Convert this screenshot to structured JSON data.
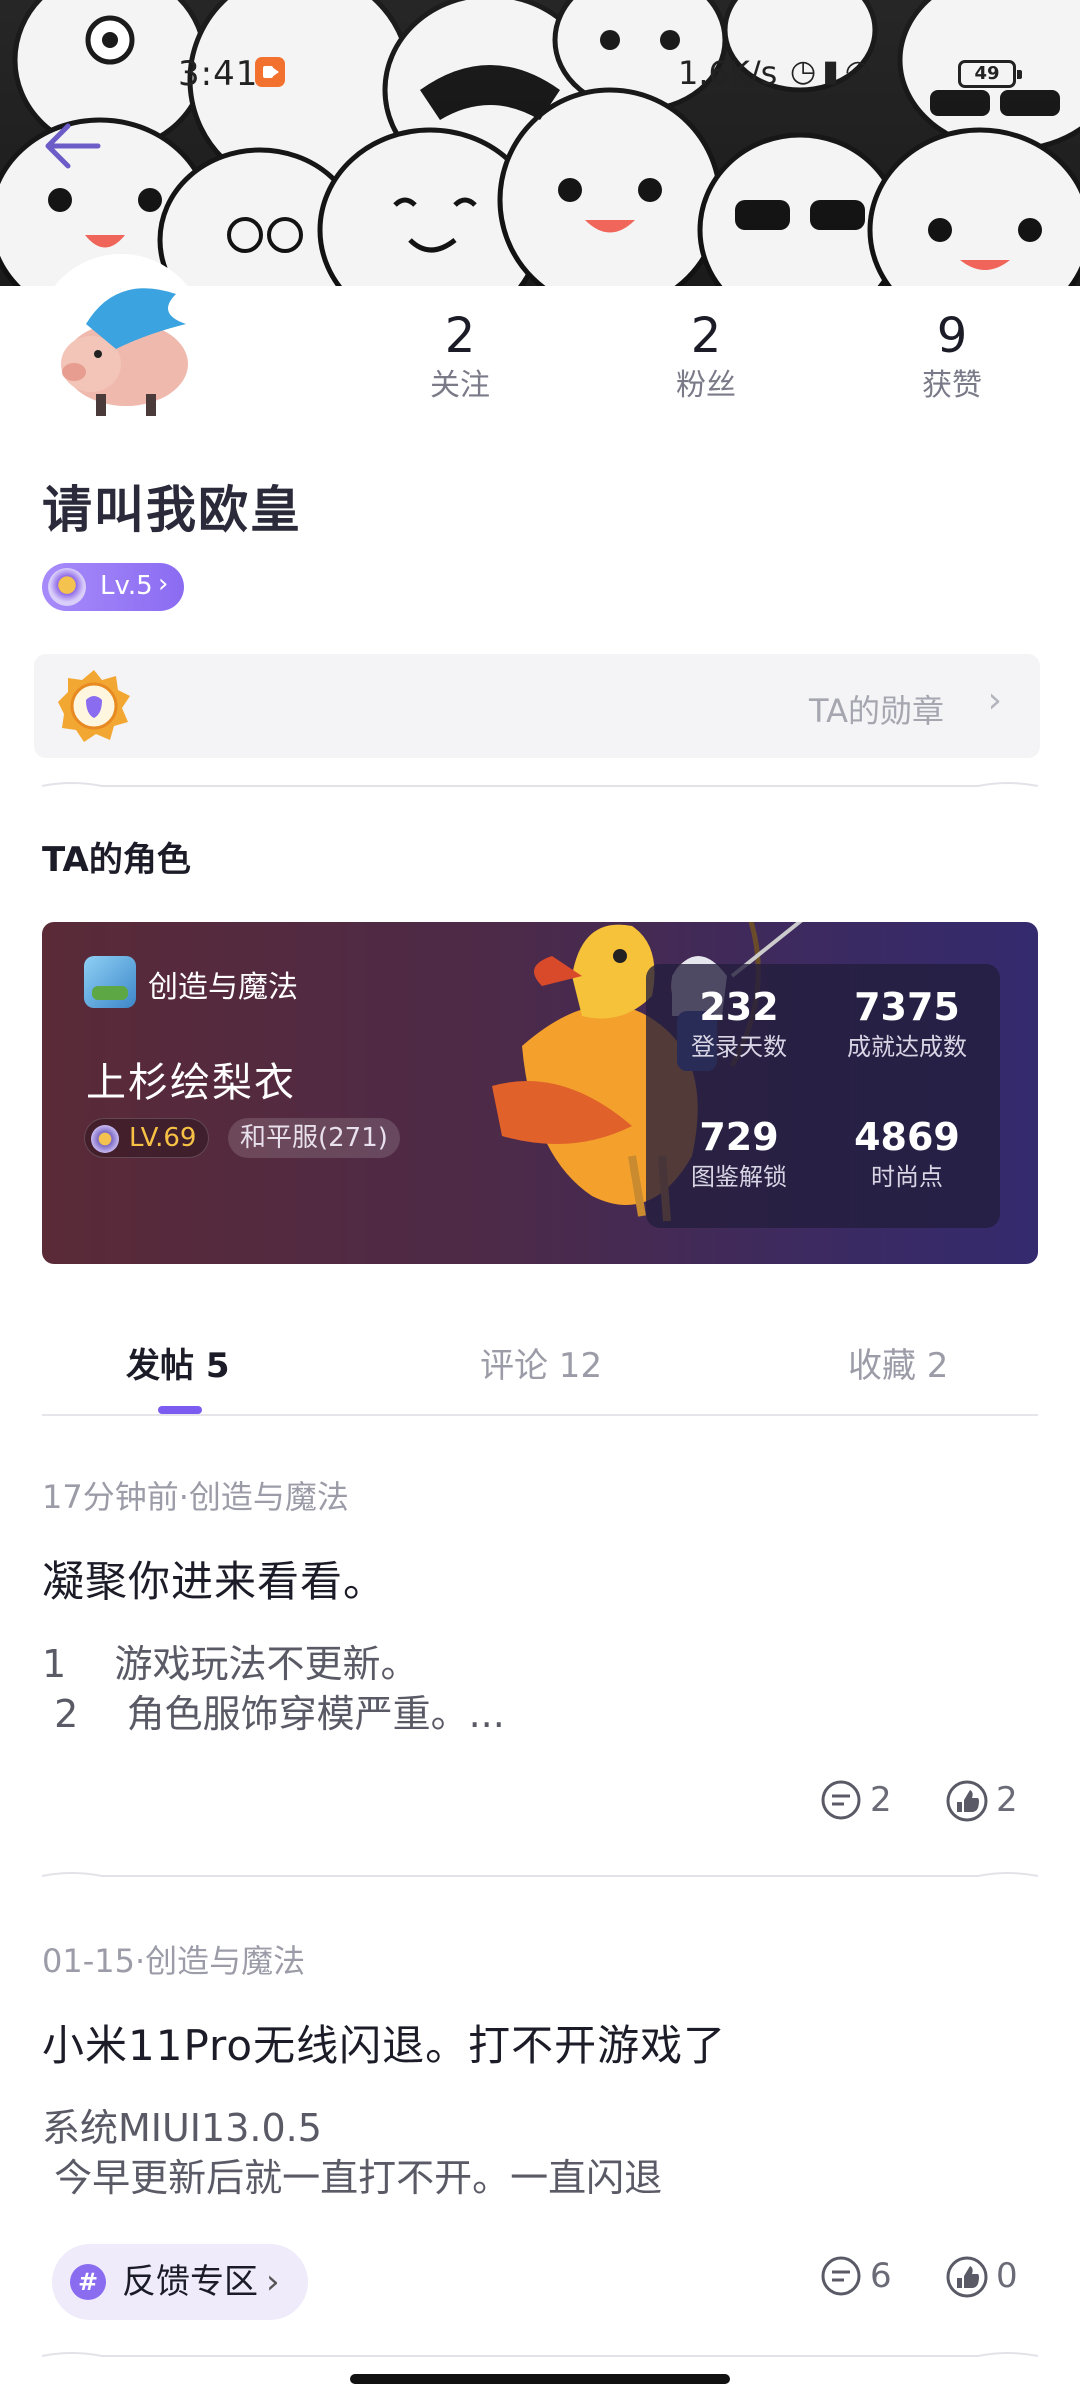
{
  "status_bar": {
    "time": "3:41",
    "net_speed": "1.6K/s",
    "icons": [
      "alarm-icon",
      "signal-icon",
      "wifi-icon"
    ],
    "battery": "49"
  },
  "profile": {
    "stats": [
      {
        "value": "2",
        "label": "关注"
      },
      {
        "value": "2",
        "label": "粉丝"
      },
      {
        "value": "9",
        "label": "获赞"
      }
    ],
    "username": "请叫我欧皇",
    "level": "Lv.5",
    "medal_label": "TA的勋章"
  },
  "character_section": {
    "title": "TA的角色",
    "game_name": "创造与魔法",
    "char_name": "上杉绘梨衣",
    "char_level": "LV.69",
    "server": "和平服(271)",
    "stats": [
      {
        "value": "232",
        "label": "登录天数"
      },
      {
        "value": "7375",
        "label": "成就达成数"
      },
      {
        "value": "729",
        "label": "图鉴解锁"
      },
      {
        "value": "4869",
        "label": "时尚点"
      }
    ]
  },
  "tabs": [
    {
      "label": "发帖 5",
      "active": true
    },
    {
      "label": "评论 12",
      "active": false
    },
    {
      "label": "收藏 2",
      "active": false
    }
  ],
  "posts": [
    {
      "meta": "17分钟前·创造与魔法",
      "title": "凝聚你进来看看。",
      "body_line1": "1    游戏玩法不更新。",
      "body_line2": " 2    角色服饰穿模严重。...",
      "comments": "2",
      "likes": "2"
    },
    {
      "meta": "01-15·创造与魔法",
      "title": "小米11Pro无线闪退。打不开游戏了",
      "body_line1": "系统MIUI13.0.5",
      "body_line2": " 今早更新后就一直打不开。一直闪退",
      "topic": "反馈专区",
      "comments": "6",
      "likes": "0"
    }
  ],
  "colors": {
    "accent": "#7b5cf0",
    "level_badge": "#9b7ff5",
    "card_bg_left": "#5a2a37",
    "card_bg_right": "#342a6e",
    "gold": "#f6c145"
  }
}
